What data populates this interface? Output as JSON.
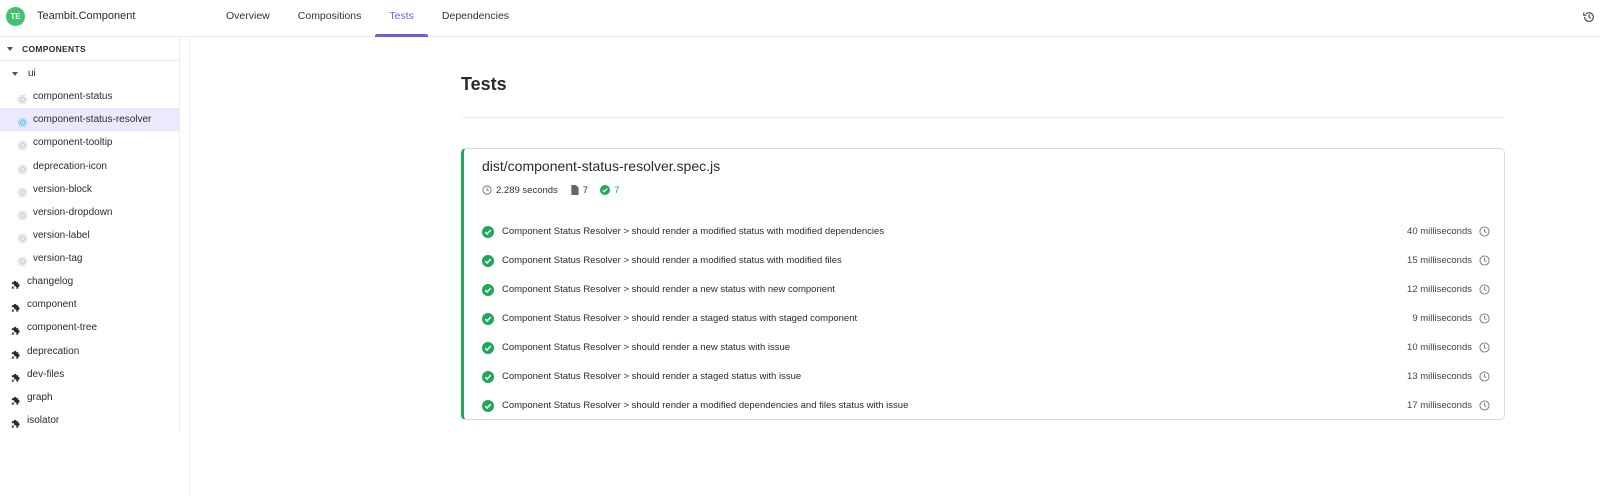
{
  "header": {
    "avatar_initials": "TE",
    "app_title": "Teambit.Component",
    "tabs": [
      {
        "label": "Overview",
        "active": false
      },
      {
        "label": "Compositions",
        "active": false
      },
      {
        "label": "Tests",
        "active": true
      },
      {
        "label": "Dependencies",
        "active": false
      }
    ]
  },
  "sidebar": {
    "section_label": "COMPONENTS",
    "folder": "ui",
    "ui_items": [
      {
        "label": "component-status",
        "selected": false
      },
      {
        "label": "component-status-resolver",
        "selected": true
      },
      {
        "label": "component-tooltip",
        "selected": false
      },
      {
        "label": "deprecation-icon",
        "selected": false
      },
      {
        "label": "version-block",
        "selected": false
      },
      {
        "label": "version-dropdown",
        "selected": false
      },
      {
        "label": "version-label",
        "selected": false
      },
      {
        "label": "version-tag",
        "selected": false
      }
    ],
    "components": [
      {
        "label": "changelog"
      },
      {
        "label": "component"
      },
      {
        "label": "component-tree"
      },
      {
        "label": "deprecation"
      },
      {
        "label": "dev-files"
      },
      {
        "label": "graph"
      },
      {
        "label": "isolator"
      }
    ]
  },
  "main": {
    "title": "Tests",
    "suite": {
      "file": "dist/component-status-resolver.spec.js",
      "duration": "2.289 seconds",
      "total_tests": "7",
      "passed_tests": "7",
      "tests": [
        {
          "name": "Component Status Resolver > should render a modified status with modified dependencies",
          "duration": "40 milliseconds",
          "status": "pass"
        },
        {
          "name": "Component Status Resolver > should render a modified status with modified files",
          "duration": "15 milliseconds",
          "status": "pass"
        },
        {
          "name": "Component Status Resolver > should render a new status with new component",
          "duration": "12 milliseconds",
          "status": "pass"
        },
        {
          "name": "Component Status Resolver > should render a staged status with staged component",
          "duration": "9 milliseconds",
          "status": "pass"
        },
        {
          "name": "Component Status Resolver > should render a new status with issue",
          "duration": "10 milliseconds",
          "status": "pass"
        },
        {
          "name": "Component Status Resolver > should render a staged status with issue",
          "duration": "13 milliseconds",
          "status": "pass"
        },
        {
          "name": "Component Status Resolver > should render a modified dependencies and files status with issue",
          "duration": "17 milliseconds",
          "status": "pass"
        }
      ]
    }
  },
  "colors": {
    "accent": "#6c5ce7",
    "pass": "#1fa85a",
    "avatar": "#3ec46d",
    "selected_bg": "#ece9fc"
  },
  "icons": {
    "react": "react-icon",
    "component": "puzzle-icon",
    "clock": "clock-icon",
    "file": "file-icon",
    "pass": "check-circle-icon",
    "history": "history-icon"
  }
}
